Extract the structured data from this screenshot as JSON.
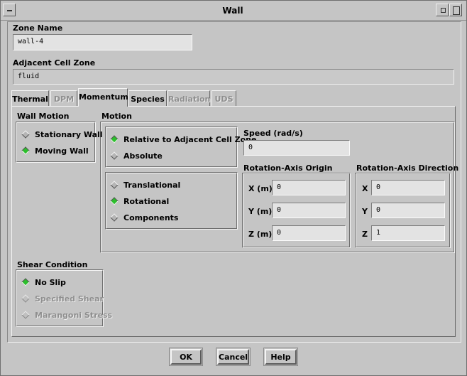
{
  "window": {
    "title": "Wall"
  },
  "zone_name": {
    "label": "Zone Name",
    "value": "wall-4"
  },
  "adjacent_cell_zone": {
    "label": "Adjacent Cell Zone",
    "value": "fluid"
  },
  "tabs": [
    "Thermal",
    "DPM",
    "Momentum",
    "Species",
    "Radiation",
    "UDS"
  ],
  "wall_motion": {
    "label": "Wall Motion",
    "options": [
      "Stationary Wall",
      "Moving Wall"
    ],
    "selected": "Moving Wall"
  },
  "motion": {
    "label": "Motion",
    "frame_options": [
      "Relative to Adjacent Cell Zone",
      "Absolute"
    ],
    "frame_selected": "Relative to Adjacent Cell Zone",
    "type_options": [
      "Translational",
      "Rotational",
      "Components"
    ],
    "type_selected": "Rotational"
  },
  "speed": {
    "label": "Speed (rad/s)",
    "value": "0"
  },
  "rotation_axis_origin": {
    "label": "Rotation-Axis Origin",
    "x_label": "X (m)",
    "x_value": "0",
    "y_label": "Y (m)",
    "y_value": "0",
    "z_label": "Z (m)",
    "z_value": "0"
  },
  "rotation_axis_direction": {
    "label": "Rotation-Axis Direction",
    "x_label": "X",
    "x_value": "0",
    "y_label": "Y",
    "y_value": "0",
    "z_label": "Z",
    "z_value": "1"
  },
  "shear_condition": {
    "label": "Shear Condition",
    "options": [
      "No Slip",
      "Specified Shear",
      "Marangoni Stress"
    ],
    "selected": "No Slip"
  },
  "buttons": {
    "ok": "OK",
    "cancel": "Cancel",
    "help": "Help"
  },
  "colors": {
    "background": "#c5c5c5",
    "radio_selected": "#2cbf2c",
    "field": "#e3e3e3"
  }
}
